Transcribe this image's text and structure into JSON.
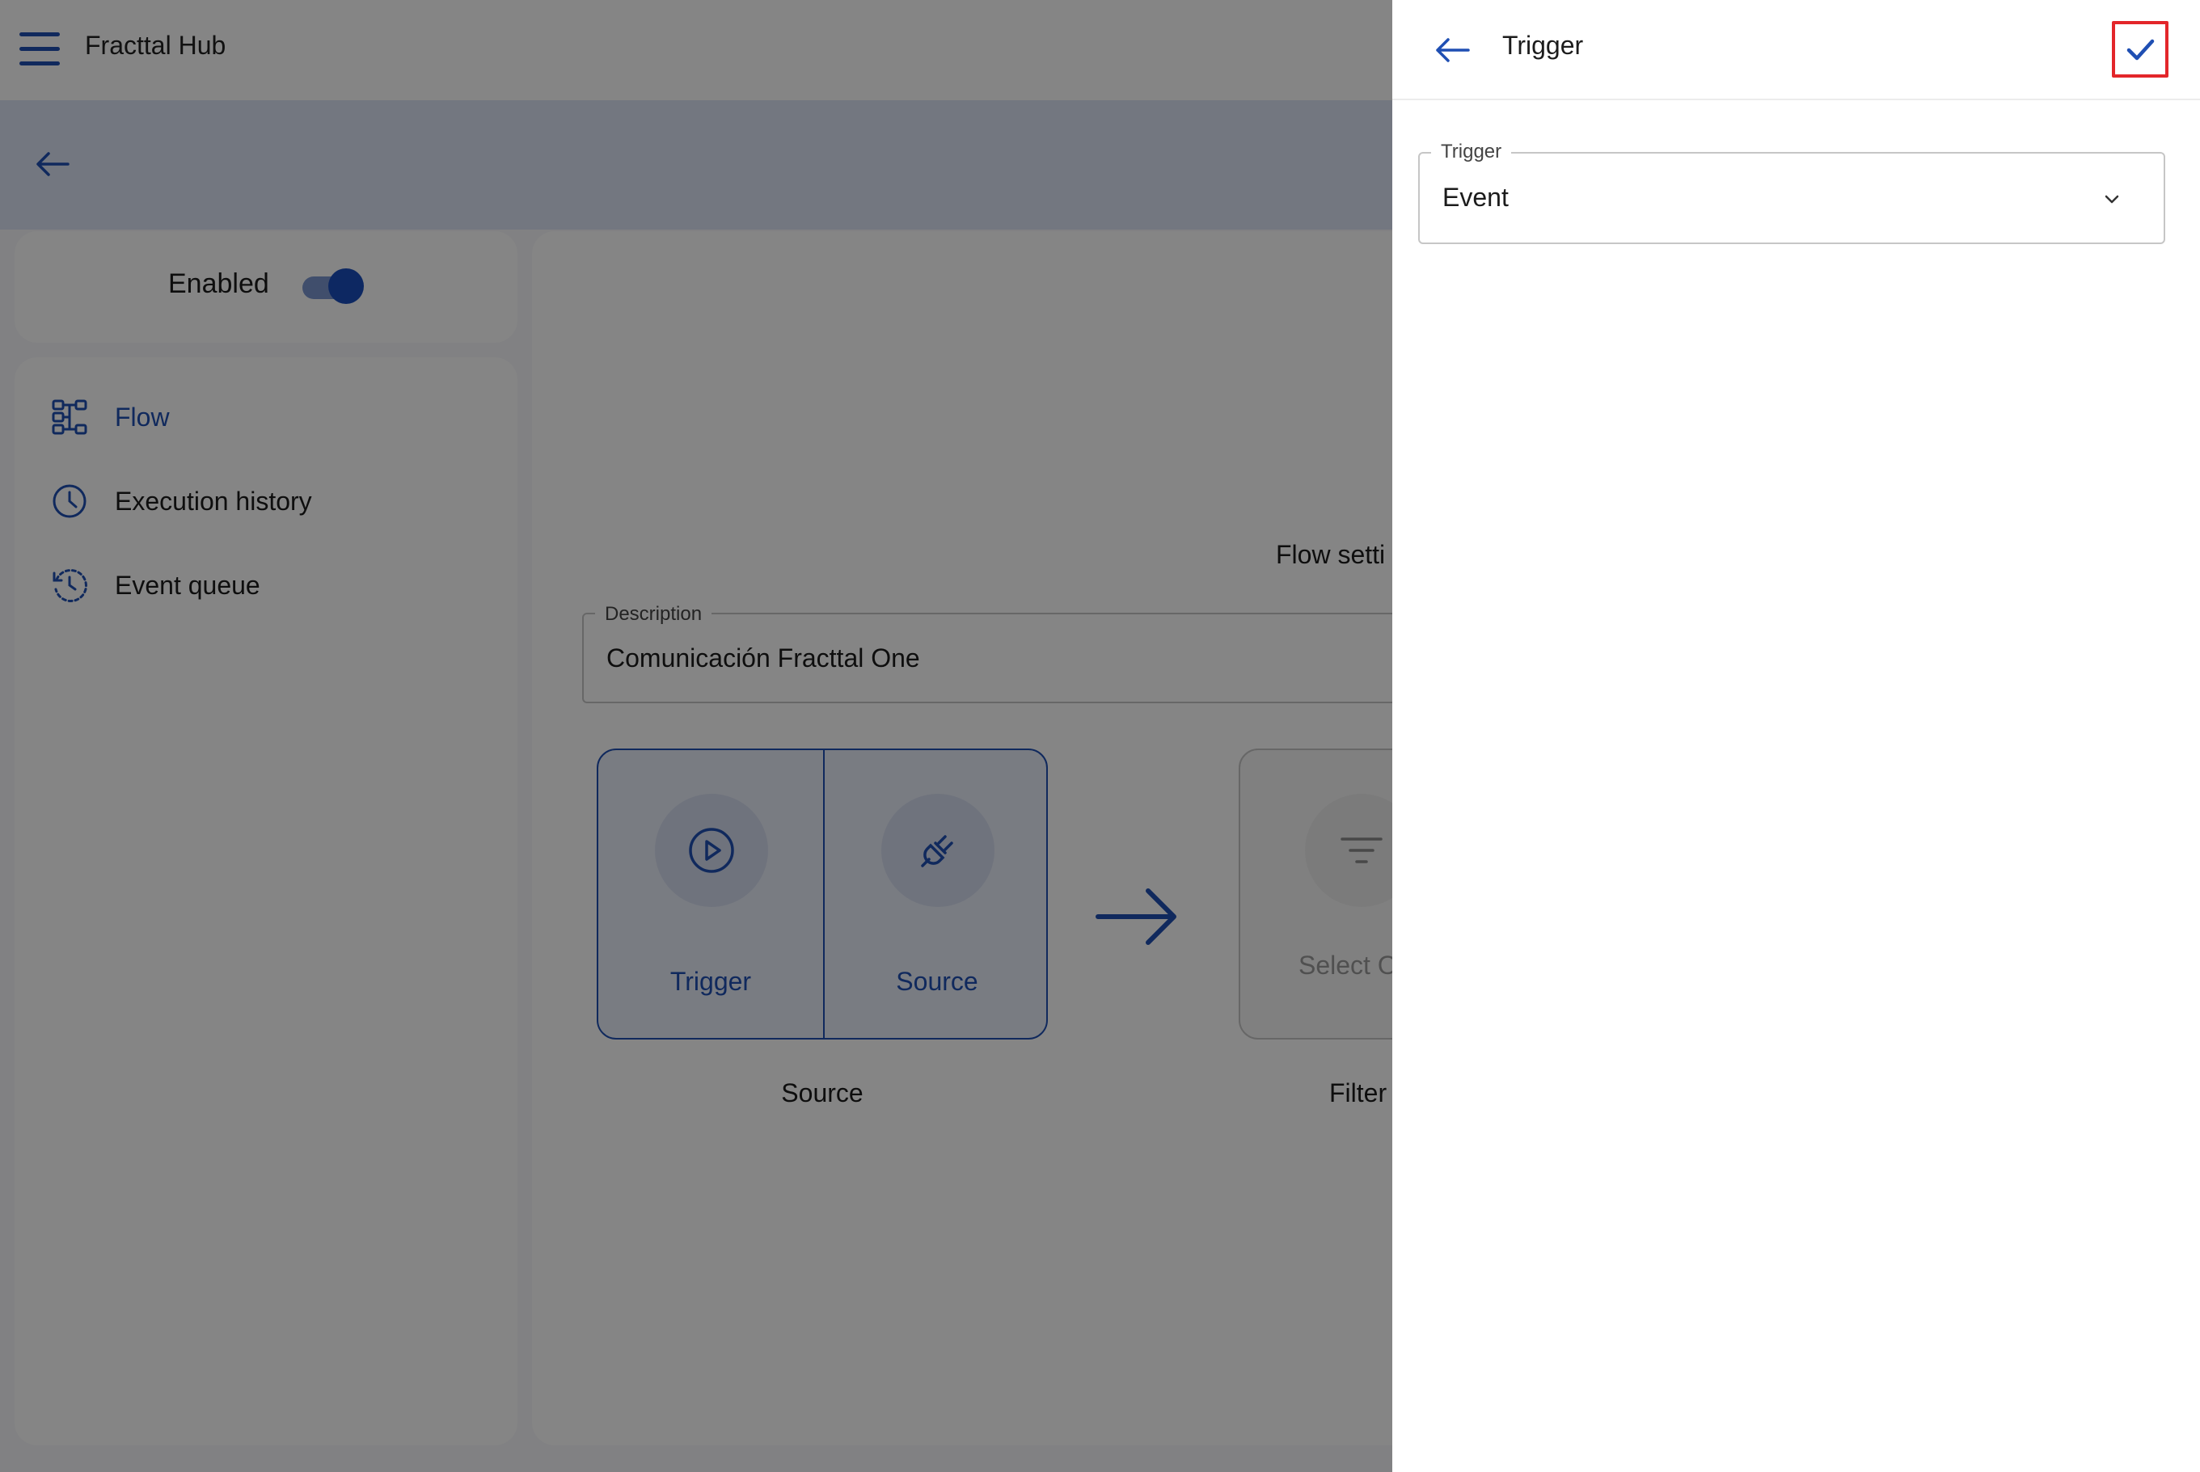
{
  "appbar": {
    "title": "Fracttal Hub",
    "menu_icon": "menu-icon"
  },
  "subbar": {
    "back_icon": "arrow-left-icon"
  },
  "status": {
    "enabled_label": "Enabled",
    "enabled": true
  },
  "sidebar": {
    "items": [
      {
        "label": "Flow",
        "icon": "flow-icon",
        "active": true
      },
      {
        "label": "Execution history",
        "icon": "clock-icon",
        "active": false
      },
      {
        "label": "Event queue",
        "icon": "history-icon",
        "active": false
      }
    ]
  },
  "main": {
    "flow_settings_label": "Flow setti",
    "description": {
      "label": "Description",
      "value": "Comunicación Fracttal One"
    },
    "source_block": {
      "trigger_label": "Trigger",
      "source_label": "Source",
      "caption": "Source"
    },
    "filter_block": {
      "select_label": "Select O",
      "caption": "Filter"
    }
  },
  "drawer": {
    "title": "Trigger",
    "trigger_field": {
      "label": "Trigger",
      "value": "Event"
    }
  },
  "colors": {
    "accent": "#1f4fb3",
    "confirm_highlight": "#e3262a"
  }
}
